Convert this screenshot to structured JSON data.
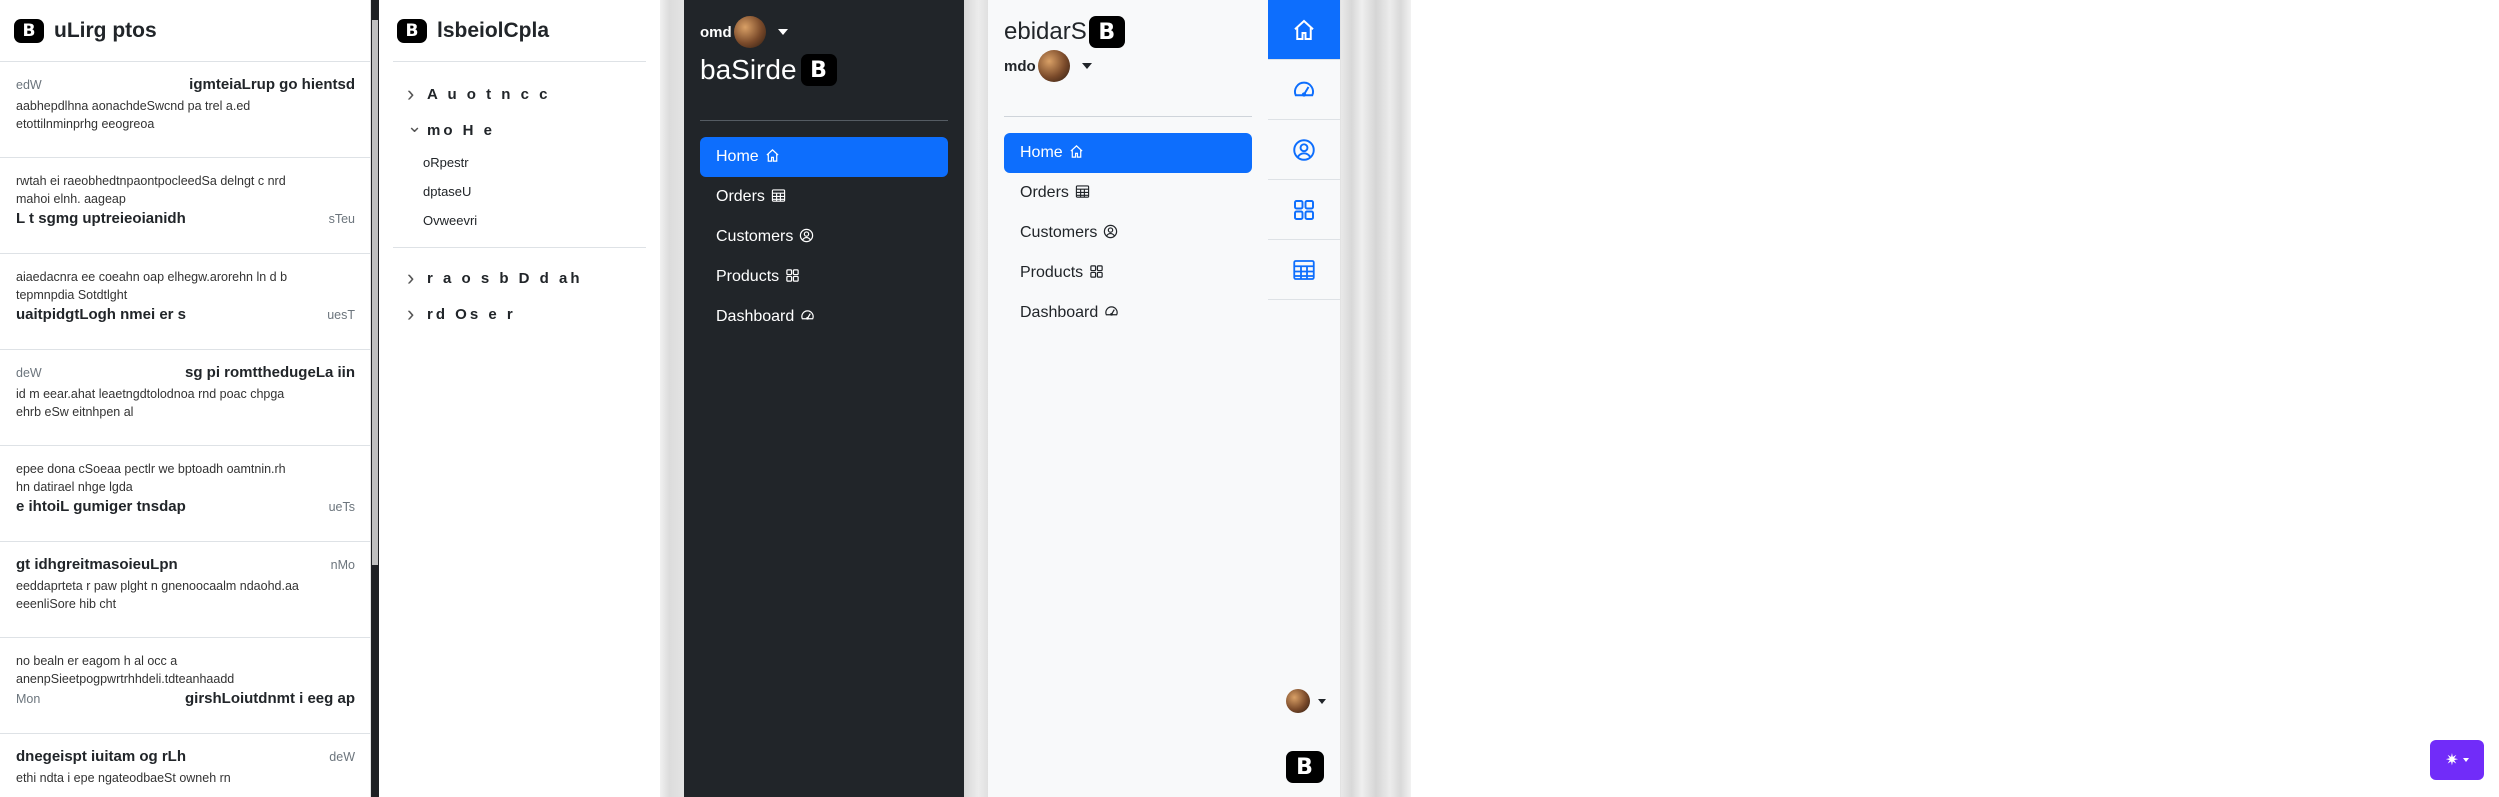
{
  "list_panel": {
    "title": "uLirg ptos",
    "items": [
      {
        "title": "igmteiaLrup go hientsd",
        "date": "edW",
        "body": "aabhepdlhna aonachdeSwcnd pa trel a.ed etottilnminprhg eeogreoa",
        "layout": "title-first"
      },
      {
        "title": "L t sgmg uptreieoianidh",
        "date": "sTeu",
        "body": "rwtah ei raeobhedtnpaontpocleedSa delngt c nrd mahoi elnh. aageap",
        "layout": "body-first"
      },
      {
        "title": "uaitpidgtLogh nmei er s",
        "date": "uesT",
        "body": "aiaedacnra ee coeahn oap elhegw.arorehn ln d b tepmnpdia Sotdtlght",
        "layout": "body-first"
      },
      {
        "title": "sg pi romtthedugeLa iin",
        "date": "deW",
        "body": "id m eear.ahat leaetngdtolodnoa rnd poac chpga ehrb eSw eitnhpen al",
        "layout": "title-first"
      },
      {
        "title": "e ihtoiL gumiger tnsdap",
        "date": "ueTs",
        "body": "epee dona cSoeaa pectlr we bptoadh oamtnin.rh hn datirael nhge lgda",
        "layout": "body-first"
      },
      {
        "title": "gt idhgreitmasoieuLpn",
        "date": "nMo",
        "body": "eeddaprteta r paw plght n gnenoocaalm ndaohd.aa eeenliSore hib cht",
        "layout": "title-first"
      },
      {
        "title": "girshLoiutdnmt i eeg ap",
        "date": "Mon",
        "body": "no bealn er eagom h al occ a anenpSieetpogpwrtrhhdeli.tdteanhaadd",
        "layout": "body-first"
      },
      {
        "title": "dnegeispt iuitam og rLh",
        "date": "deW",
        "body": "ethi ndta i epe ngateodbaeSt owneh rn",
        "layout": "title-first"
      }
    ]
  },
  "collapse_panel": {
    "title": "lsbeiolCpla",
    "sections": [
      {
        "label": "A u o t n c c",
        "expanded": false,
        "children": []
      },
      {
        "label": "mo H e",
        "expanded": true,
        "children": [
          "oRpestr",
          "dptaseU",
          "Ovweevri"
        ]
      },
      {
        "label": "r a o s b D d ah",
        "expanded": false,
        "children": []
      },
      {
        "label": "rd Os e r",
        "expanded": false,
        "children": []
      }
    ]
  },
  "dark_sidebar": {
    "user": "omd",
    "brand": "baSirde",
    "nav": [
      {
        "label": "Home",
        "icon": "home-icon",
        "active": true
      },
      {
        "label": "Orders",
        "icon": "table-icon",
        "active": false
      },
      {
        "label": "Customers",
        "icon": "person-circle-icon",
        "active": false
      },
      {
        "label": "Products",
        "icon": "grid-icon",
        "active": false
      },
      {
        "label": "Dashboard",
        "icon": "speedometer-icon",
        "active": false
      }
    ]
  },
  "light_sidebar": {
    "brand": "ebidarS",
    "user": "mdo",
    "nav": [
      {
        "label": "Home",
        "icon": "home-icon",
        "active": true
      },
      {
        "label": "Orders",
        "icon": "table-icon",
        "active": false
      },
      {
        "label": "Customers",
        "icon": "person-circle-icon",
        "active": false
      },
      {
        "label": "Products",
        "icon": "grid-icon",
        "active": false
      },
      {
        "label": "Dashboard",
        "icon": "speedometer-icon",
        "active": false
      }
    ]
  },
  "icon_bar": {
    "items": [
      "home-icon",
      "speedometer-icon",
      "person-circle-icon",
      "grid-icon",
      "table-icon"
    ]
  },
  "colors": {
    "primary": "#0d6efd",
    "dark_bg": "#212529",
    "light_bg": "#f8f9fa",
    "theme_button": "#712cf9"
  }
}
